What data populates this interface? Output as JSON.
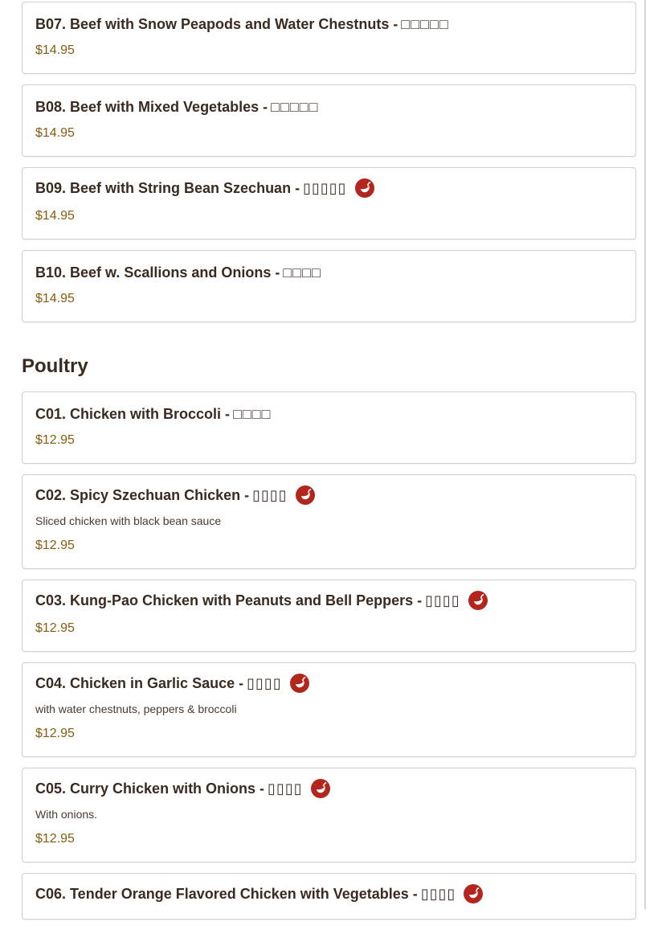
{
  "sections": [
    {
      "title": "",
      "items": [
        {
          "name": "B07. Beef with Snow Peapods and Water Chestnuts - ",
          "chinese": "□□□□□",
          "spicy": false,
          "description": "",
          "price": "$14.95"
        },
        {
          "name": "B08. Beef with Mixed Vegetables - ",
          "chinese": "□□□□□",
          "spicy": false,
          "description": "",
          "price": "$14.95"
        },
        {
          "name": "B09. Beef with String Bean Szechuan - ",
          "chinese": "▯▯▯▯▯",
          "spicy": true,
          "description": "",
          "price": "$14.95"
        },
        {
          "name": "B10. Beef w. Scallions and Onions - ",
          "chinese": "□□□□",
          "spicy": false,
          "description": "",
          "price": "$14.95"
        }
      ]
    },
    {
      "title": "Poultry",
      "items": [
        {
          "name": "C01. Chicken with Broccoli - ",
          "chinese": "□□□□",
          "spicy": false,
          "description": "",
          "price": "$12.95"
        },
        {
          "name": "C02. Spicy Szechuan Chicken - ",
          "chinese": "▯▯▯▯",
          "spicy": true,
          "description": "Sliced chicken with black bean sauce",
          "price": "$12.95"
        },
        {
          "name": "C03. Kung-Pao Chicken with Peanuts and Bell Peppers - ",
          "chinese": "▯▯▯▯",
          "spicy": true,
          "description": "",
          "price": "$12.95"
        },
        {
          "name": "C04. Chicken in Garlic Sauce - ",
          "chinese": "▯▯▯▯",
          "spicy": true,
          "description": "with water chestnuts, peppers & broccoli",
          "price": "$12.95"
        },
        {
          "name": "C05. Curry Chicken with Onions - ",
          "chinese": "▯▯▯▯",
          "spicy": true,
          "description": "With onions.",
          "price": "$12.95"
        },
        {
          "name": "C06. Tender Orange Flavored Chicken with Vegetables - ",
          "chinese": "▯▯▯▯",
          "spicy": true,
          "description": "",
          "price": ""
        }
      ]
    }
  ],
  "colors": {
    "pepper_badge": "#b3261e",
    "price": "#8a5a10",
    "title": "#3b2a20"
  },
  "icons": {
    "spicy": "chili-pepper-icon"
  }
}
